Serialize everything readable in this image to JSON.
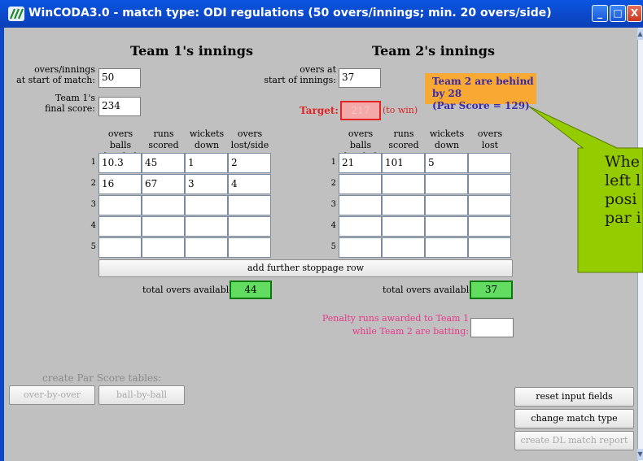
{
  "window": {
    "title": "WinCODA3.0 - match type: ODI regulations (50 overs/innings; min. 20 overs/side)",
    "buttons": {
      "minimize": "_",
      "maximize": "□",
      "close": "X"
    }
  },
  "team1": {
    "heading": "Team 1's innings",
    "overs_label_line1": "overs/innings",
    "overs_label_line2": "at start of match:",
    "overs_value": "50",
    "score_label_line1": "Team 1's",
    "score_label_line2": "final score:",
    "score_value": "234",
    "columns": [
      {
        "line1": "overs balls",
        "line2": "bowled"
      },
      {
        "line1": "runs",
        "line2": "scored"
      },
      {
        "line1": "wickets",
        "line2": "down"
      },
      {
        "line1": "overs",
        "line2": "lost/side"
      }
    ],
    "row_numbers": [
      "1",
      "2",
      "3",
      "4",
      "5"
    ],
    "rows": [
      [
        "10.3",
        "45",
        "1",
        "2"
      ],
      [
        "16",
        "67",
        "3",
        "4"
      ],
      [
        "",
        "",
        "",
        ""
      ],
      [
        "",
        "",
        "",
        ""
      ],
      [
        "",
        "",
        "",
        ""
      ]
    ],
    "total_label": "total overs available:",
    "total_value": "44"
  },
  "team2": {
    "heading": "Team 2's innings",
    "overs_label_line1": "overs at",
    "overs_label_line2": "start of innings:",
    "overs_value": "37",
    "target_label": "Target:",
    "target_value": "217",
    "to_win": "(to win)",
    "columns": [
      {
        "line1": "overs balls",
        "line2": "bowled"
      },
      {
        "line1": "runs",
        "line2": "scored"
      },
      {
        "line1": "wickets",
        "line2": "down"
      },
      {
        "line1": "overs",
        "line2": "lost"
      }
    ],
    "row_numbers": [
      "1",
      "2",
      "3",
      "4",
      "5"
    ],
    "rows": [
      [
        "21",
        "101",
        "5",
        ""
      ],
      [
        "",
        "",
        "",
        ""
      ],
      [
        "",
        "",
        "",
        ""
      ],
      [
        "",
        "",
        "",
        ""
      ],
      [
        "",
        "",
        "",
        ""
      ]
    ],
    "total_label": "total overs available:",
    "total_value": "37",
    "penalty_line1": "Penalty runs awarded to Team 1",
    "penalty_line2": "while Team 2 are batting:",
    "penalty_value": ""
  },
  "status": {
    "line1": "Team 2 are behind by 28",
    "line2": "(Par Score = 129)"
  },
  "callout": {
    "line1": "Whe",
    "line2": "left l",
    "line3": "posi",
    "line4": "par i"
  },
  "add_row_button": "add further stoppage row",
  "par_tables": {
    "label": "create Par Score tables:",
    "over_by_over": "over-by-over",
    "ball_by_ball": "ball-by-ball"
  },
  "actions": {
    "reset": "reset input fields",
    "change_type": "change match type",
    "report": "create DL match report"
  },
  "colors": {
    "titlebar": "#0b48c8",
    "status_bg": "#f7a934",
    "status_text": "#3a2aa8",
    "callout_bg": "#95cc00",
    "target_red": "#e02424",
    "penalty_pink": "#e8388a",
    "total_green": "#62dd62"
  }
}
